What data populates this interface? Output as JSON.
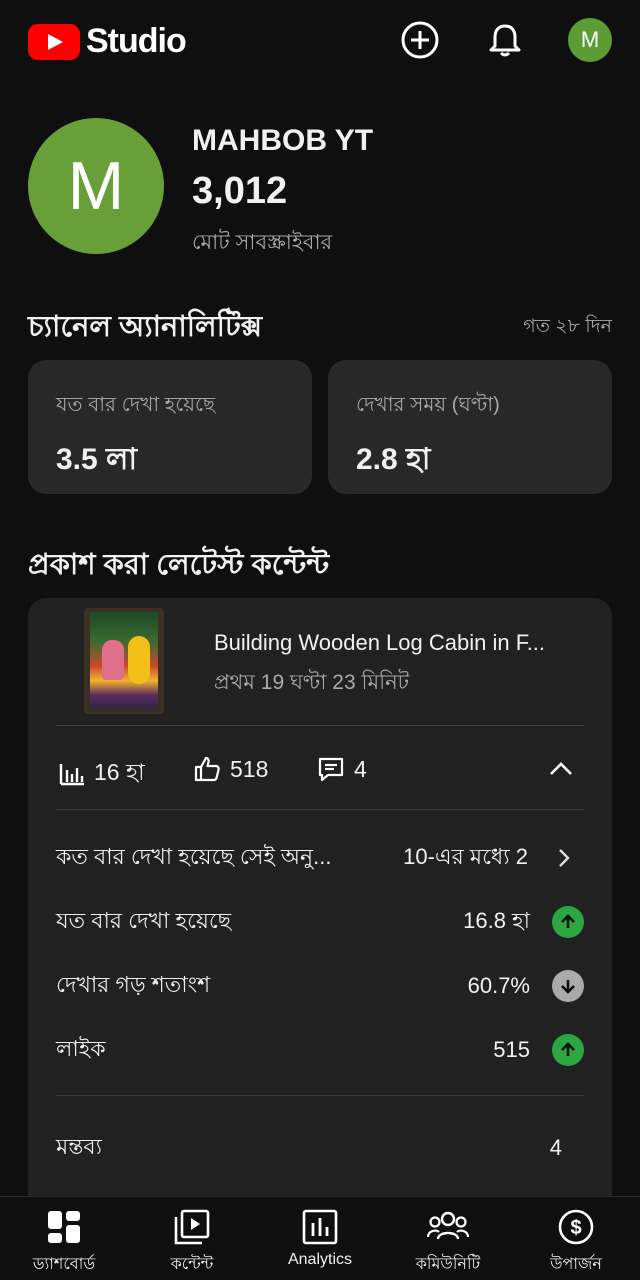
{
  "app": {
    "logo_text": "Studio",
    "avatar_letter": "M"
  },
  "channel": {
    "avatar_letter": "M",
    "name": "MAHBOB YT",
    "subscribers": "3,012",
    "subscribers_label": "মোট সাবস্ক্রাইবার"
  },
  "analytics": {
    "title": "চ্যানেল অ্যানালিটিক্স",
    "period": "গত ২৮ দিন",
    "cards": [
      {
        "label": "যত বার দেখা হয়েছে",
        "value": "3.5 লা"
      },
      {
        "label": "দেখার সময় (ঘণ্টা)",
        "value": "2.8 হা"
      }
    ]
  },
  "latest": {
    "title": "প্রকাশ করা লেটেস্ট কন্টেন্ট",
    "video_title": "Building Wooden Log Cabin in F...",
    "video_subtitle": "প্রথম 19 ঘণ্টা 23 মিনিট",
    "metrics": {
      "views": "16 হা",
      "likes": "518",
      "comments": "4"
    },
    "rows": [
      {
        "label": "কত বার দেখা হয়েছে সেই অনু...",
        "value": "10-এর মধ্যে 2",
        "indicator": "chevron"
      },
      {
        "label": "যত বার দেখা হয়েছে",
        "value": "16.8 হা",
        "indicator": "up"
      },
      {
        "label": "দেখার গড় শতাংশ",
        "value": "60.7%",
        "indicator": "down"
      },
      {
        "label": "লাইক",
        "value": "515",
        "indicator": "up"
      }
    ],
    "extra_rows": [
      {
        "label": "মন্তব্য",
        "value": "4"
      }
    ]
  },
  "bottom_nav": [
    {
      "label": "ড্যাশবোর্ড",
      "icon": "dashboard-icon"
    },
    {
      "label": "কন্টেন্ট",
      "icon": "content-icon"
    },
    {
      "label": "Analytics",
      "icon": "analytics-icon"
    },
    {
      "label": "কমিউনিটি",
      "icon": "community-icon"
    },
    {
      "label": "উপার্জন",
      "icon": "earn-icon"
    }
  ],
  "colors": {
    "background": "#0f0f0f",
    "card": "#282828",
    "accent_red": "#ff0000",
    "avatar_green": "#689f38",
    "trend_up": "#2ba640",
    "trend_down": "#aaaaaa"
  }
}
